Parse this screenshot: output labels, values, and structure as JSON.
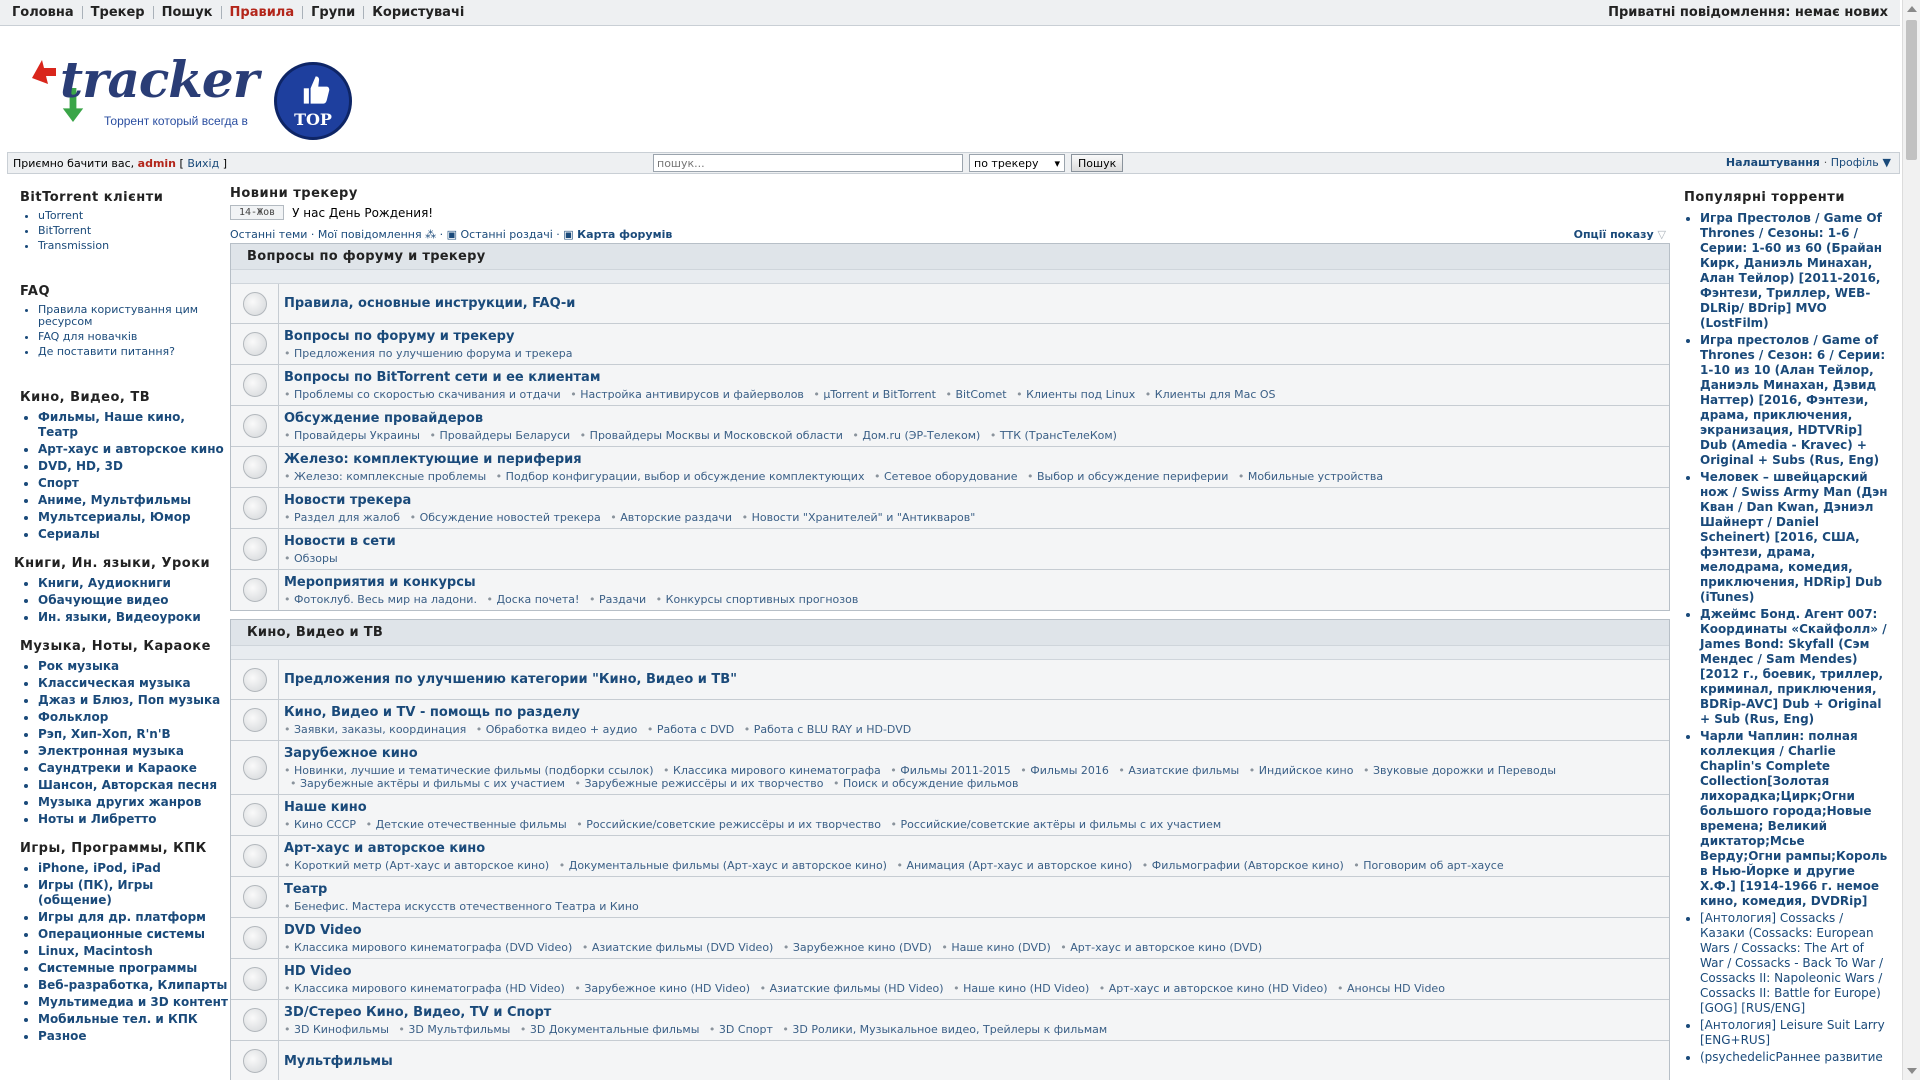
{
  "topnav": {
    "items": [
      {
        "label": "Головна"
      },
      {
        "label": "Трекер"
      },
      {
        "label": "Пошук"
      },
      {
        "label": "Правила"
      },
      {
        "label": "Групи"
      },
      {
        "label": "Користувачі"
      }
    ],
    "private_messages": "Приватні повідомлення: немає нових"
  },
  "logo": {
    "word": "tracker",
    "subtitle": "Торрент который всегда в",
    "badge": "TOP"
  },
  "welcome": {
    "greeting": "Приємно бачити вас,",
    "username": "admin",
    "exit": "Вихід",
    "search_placeholder": "пошук...",
    "search_scope": "по трекеру",
    "search_button": "Пошук",
    "settings": "Налаштування",
    "profile": "Профіль"
  },
  "left": {
    "sections": [
      {
        "title": "BitTorrent клієнти",
        "items": [
          "uTorrent",
          "BitTorrent",
          "Transmission"
        ]
      },
      {
        "title": "FAQ",
        "items": [
          "Правила користування цим ресурсом",
          "FAQ для новачків",
          "Де поставити питання?"
        ]
      },
      {
        "title": "Кино, Видео, ТВ",
        "items": [
          "Фильмы, Наше кино, Театр",
          "Арт-хаус и авторское кино",
          "DVD, HD, 3D",
          "Спорт",
          "Аниме, Мультфильмы",
          "Мультсериалы, Юмор",
          "Сериалы"
        ]
      },
      {
        "title": "Книги, Ин. языки, Уроки",
        "items": [
          "Книги, Аудиокниги",
          "Обачующие видео",
          "Ин. языки, Видеоуроки"
        ]
      },
      {
        "title": "Музыка, Ноты, Караоке",
        "items": [
          "Рок музыка",
          "Классическая музыка",
          "Джаз и Блюз, Поп музыка",
          "Фольклор",
          "Рэп, Хип-Хоп, R'n'B",
          "Электронная музыка",
          "Саундтреки и Караоке",
          "Шансон, Авторская песня",
          "Музыка других жанров",
          "Ноты и Либретто"
        ]
      },
      {
        "title": "Игры, Программы, КПК",
        "items": [
          "iPhone, iPod, iPad",
          "Игры (ПК), Игры (общение)",
          "Игры для др. платформ",
          "Операционные системы",
          "Linux, Macintosh",
          "Системные программы",
          "Веб-разработка, Клипарты",
          "Мультимедиа и 3D контент",
          "Мобильные тел. и КПК",
          "Разное"
        ]
      }
    ]
  },
  "center": {
    "news_title": "Новини трекеру",
    "news": [
      {
        "date": "14-Жов",
        "text": "У нас День Рождения!"
      }
    ],
    "links": {
      "latest_topics": "Останні теми",
      "my_messages": "Мої повідомлення",
      "latest_releases": "Останні роздачі",
      "forum_map": "Карта форумів",
      "display_options": "Опції показу"
    },
    "categories": [
      {
        "title": "Вопросы по форуму и трекеру",
        "forums": [
          {
            "name": "Правила, основные инструкции, FAQ-и",
            "subs": []
          },
          {
            "name": "Вопросы по форуму и трекеру",
            "subs": [
              "Предложения по улучшению форума и трекера"
            ]
          },
          {
            "name": "Вопросы по BitTorrent сети и ее клиентам",
            "subs": [
              "Проблемы со скоростью скачивания и отдачи",
              "Настройка антивирусов и файерволов",
              "µTorrent и BitTorrent",
              "BitComet",
              "Клиенты под Linux",
              "Клиенты для Mac OS"
            ]
          },
          {
            "name": "Обсуждение провайдеров",
            "subs": [
              "Провайдеры Украины",
              "Провайдеры Беларуси",
              "Провайдеры Москвы и Московской области",
              "Дом.ru (ЭР-Телеком)",
              "ТТК (ТрансТелеКом)"
            ]
          },
          {
            "name": "Железо: комплектующие и периферия",
            "subs": [
              "Железо: комплексные проблемы",
              "Подбор конфигурации, выбор и обсуждение комплектующих",
              "Сетевое оборудование",
              "Выбор и обсуждение периферии",
              "Мобильные устройства"
            ]
          },
          {
            "name": "Новости трекера",
            "subs": [
              "Раздел для жалоб",
              "Обсуждение новостей трекера",
              "Авторские раздачи",
              "Новости \"Хранителей\" и \"Антикваров\""
            ]
          },
          {
            "name": "Новости в сети",
            "subs": [
              "Обзоры"
            ]
          },
          {
            "name": "Мероприятия и конкурсы",
            "subs": [
              "Фотоклуб. Весь мир на ладони.",
              "Доска почета!",
              "Раздачи",
              "Конкурсы спортивных прогнозов"
            ]
          }
        ]
      },
      {
        "title": "Кино, Видео и ТВ",
        "forums": [
          {
            "name": "Предложения по улучшению категории \"Кино, Видео и ТВ\"",
            "subs": []
          },
          {
            "name": "Кино, Видео и TV - помощь по разделу",
            "subs": [
              "Заявки, заказы, координация",
              "Обработка видео + аудио",
              "Работа с DVD",
              "Работа с BLU RAY и HD-DVD"
            ]
          },
          {
            "name": "Зарубежное кино",
            "subs": [
              "Новинки, лучшие и тематические фильмы (подборки ссылок)",
              "Классика мирового кинематографа",
              "Фильмы 2011-2015",
              "Фильмы 2016",
              "Азиатские фильмы",
              "Индийское кино",
              "Звуковые дорожки и Переводы",
              "Зарубежные актёры и фильмы с их участием",
              "Зарубежные режиссёры и их творчество",
              "Поиск и обсуждение фильмов"
            ]
          },
          {
            "name": "Наше кино",
            "subs": [
              "Кино СССР",
              "Детские отечественные фильмы",
              "Российские/советские режиссёры и их творчество",
              "Российские/советские актёры и фильмы с их участием"
            ]
          },
          {
            "name": "Арт-хаус и авторское кино",
            "subs": [
              "Короткий метр (Арт-хаус и авторское кино)",
              "Документальные фильмы (Арт-хаус и авторское кино)",
              "Анимация (Арт-хаус и авторское кино)",
              "Фильмографии (Авторское кино)",
              "Поговорим об арт-хаусе"
            ]
          },
          {
            "name": "Театр",
            "subs": [
              "Бенефис. Мастера искусств отечественного Театра и Кино"
            ]
          },
          {
            "name": "DVD Video",
            "subs": [
              "Классика мирового кинематографа (DVD Video)",
              "Азиатские фильмы (DVD Video)",
              "Зарубежное кино (DVD)",
              "Наше кино (DVD)",
              "Арт-хаус и авторское кино (DVD)"
            ]
          },
          {
            "name": "HD Video",
            "subs": [
              "Классика мирового кинематографа (HD Video)",
              "Зарубежное кино (HD Video)",
              "Азиатские фильмы (HD Video)",
              "Наше кино (HD Video)",
              "Арт-хаус и авторское кино (HD Video)",
              "Анонсы HD Video"
            ]
          },
          {
            "name": "3D/Стерео Кино, Видео, TV и Спорт",
            "subs": [
              "3D Кинофильмы",
              "3D Мультфильмы",
              "3D Документальные фильмы",
              "3D Спорт",
              "3D Ролики, Музыкальное видео, Трейлеры к фильмам"
            ]
          },
          {
            "name": "Мультфильмы",
            "subs": []
          }
        ]
      }
    ]
  },
  "right": {
    "title": "Популярні торренти",
    "items": [
      {
        "text": "Игра Престолов / Game Of Thrones / Сезоны: 1-6 / Серии: 1-60 из 60 (Брайан Кирк, Даниэль Минахан, Алан Тейлор) [2011-2016, Фэнтези, Триллер, WEB-DLRip/ BDrip] MVO (LostFilm)",
        "bold": true
      },
      {
        "text": "Игра престолов / Game of Thrones / Сезон: 6 / Серии: 1-10 из 10 (Алан Тейлор, Даниэль Минахан, Дэвид Наттер) [2016, Фэнтези, драма, приключения, экранизация, HDTVRip] Dub (Amedia - Kravec) + Original + Subs (Rus, Eng)",
        "bold": true
      },
      {
        "text": "Человек – швейцарский нож / Swiss Army Man (Дэн Кван / Dan Kwan, Дэниэл Шайнерт / Daniel Scheinert) [2016, США, фэнтези, драма, мелодрама, комедия, приключения, HDRip] Dub (iTunes)",
        "bold": true
      },
      {
        "text": "Джеймс Бонд. Агент 007: Координаты «Скайфолл» / James Bond: Skyfall (Сэм Мендес / Sam Mendes) [2012 г., боевик, триллер, криминал, приключения, BDRip-AVC] Dub + Original + Sub (Rus, Eng)",
        "bold": true
      },
      {
        "text": "Чарли Чаплин: полная коллекция / Charlie Chaplin's Complete Collection[Золотая лихорадка;Цирк;Огни большого города;Новые времена; Великий диктатор;Мсье Верду;Огни рампы;Король в Нью-Йорке и другие Х.Ф.] [1914-1966 г. немое кино, комедия, DVDRip]",
        "bold": true
      },
      {
        "text": "[Антология] Cossacks / Казаки (Cossacks: European Wars / Cossacks: The Art of War / Cossacks - Back To War / Cossacks II: Napoleonic Wars / Cossacks II: Battle for Europe) [GOG] [RUS/ENG]",
        "bold": false
      },
      {
        "text": "[Антология] Leisure Suit Larry [ENG+RUS]",
        "bold": false
      },
      {
        "text": "(psychedelicРаннее развитие",
        "bold": false
      }
    ]
  }
}
